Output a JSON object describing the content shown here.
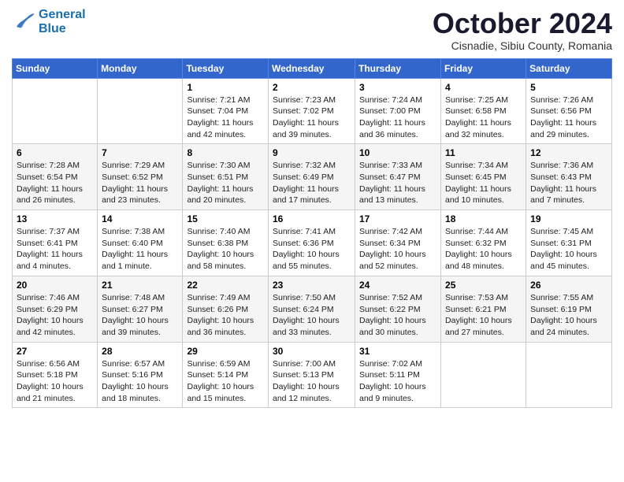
{
  "header": {
    "logo_line1": "General",
    "logo_line2": "Blue",
    "month": "October 2024",
    "location": "Cisnadie, Sibiu County, Romania"
  },
  "weekdays": [
    "Sunday",
    "Monday",
    "Tuesday",
    "Wednesday",
    "Thursday",
    "Friday",
    "Saturday"
  ],
  "weeks": [
    [
      {
        "day": "",
        "sunrise": "",
        "sunset": "",
        "daylight": ""
      },
      {
        "day": "",
        "sunrise": "",
        "sunset": "",
        "daylight": ""
      },
      {
        "day": "1",
        "sunrise": "Sunrise: 7:21 AM",
        "sunset": "Sunset: 7:04 PM",
        "daylight": "Daylight: 11 hours and 42 minutes."
      },
      {
        "day": "2",
        "sunrise": "Sunrise: 7:23 AM",
        "sunset": "Sunset: 7:02 PM",
        "daylight": "Daylight: 11 hours and 39 minutes."
      },
      {
        "day": "3",
        "sunrise": "Sunrise: 7:24 AM",
        "sunset": "Sunset: 7:00 PM",
        "daylight": "Daylight: 11 hours and 36 minutes."
      },
      {
        "day": "4",
        "sunrise": "Sunrise: 7:25 AM",
        "sunset": "Sunset: 6:58 PM",
        "daylight": "Daylight: 11 hours and 32 minutes."
      },
      {
        "day": "5",
        "sunrise": "Sunrise: 7:26 AM",
        "sunset": "Sunset: 6:56 PM",
        "daylight": "Daylight: 11 hours and 29 minutes."
      }
    ],
    [
      {
        "day": "6",
        "sunrise": "Sunrise: 7:28 AM",
        "sunset": "Sunset: 6:54 PM",
        "daylight": "Daylight: 11 hours and 26 minutes."
      },
      {
        "day": "7",
        "sunrise": "Sunrise: 7:29 AM",
        "sunset": "Sunset: 6:52 PM",
        "daylight": "Daylight: 11 hours and 23 minutes."
      },
      {
        "day": "8",
        "sunrise": "Sunrise: 7:30 AM",
        "sunset": "Sunset: 6:51 PM",
        "daylight": "Daylight: 11 hours and 20 minutes."
      },
      {
        "day": "9",
        "sunrise": "Sunrise: 7:32 AM",
        "sunset": "Sunset: 6:49 PM",
        "daylight": "Daylight: 11 hours and 17 minutes."
      },
      {
        "day": "10",
        "sunrise": "Sunrise: 7:33 AM",
        "sunset": "Sunset: 6:47 PM",
        "daylight": "Daylight: 11 hours and 13 minutes."
      },
      {
        "day": "11",
        "sunrise": "Sunrise: 7:34 AM",
        "sunset": "Sunset: 6:45 PM",
        "daylight": "Daylight: 11 hours and 10 minutes."
      },
      {
        "day": "12",
        "sunrise": "Sunrise: 7:36 AM",
        "sunset": "Sunset: 6:43 PM",
        "daylight": "Daylight: 11 hours and 7 minutes."
      }
    ],
    [
      {
        "day": "13",
        "sunrise": "Sunrise: 7:37 AM",
        "sunset": "Sunset: 6:41 PM",
        "daylight": "Daylight: 11 hours and 4 minutes."
      },
      {
        "day": "14",
        "sunrise": "Sunrise: 7:38 AM",
        "sunset": "Sunset: 6:40 PM",
        "daylight": "Daylight: 11 hours and 1 minute."
      },
      {
        "day": "15",
        "sunrise": "Sunrise: 7:40 AM",
        "sunset": "Sunset: 6:38 PM",
        "daylight": "Daylight: 10 hours and 58 minutes."
      },
      {
        "day": "16",
        "sunrise": "Sunrise: 7:41 AM",
        "sunset": "Sunset: 6:36 PM",
        "daylight": "Daylight: 10 hours and 55 minutes."
      },
      {
        "day": "17",
        "sunrise": "Sunrise: 7:42 AM",
        "sunset": "Sunset: 6:34 PM",
        "daylight": "Daylight: 10 hours and 52 minutes."
      },
      {
        "day": "18",
        "sunrise": "Sunrise: 7:44 AM",
        "sunset": "Sunset: 6:32 PM",
        "daylight": "Daylight: 10 hours and 48 minutes."
      },
      {
        "day": "19",
        "sunrise": "Sunrise: 7:45 AM",
        "sunset": "Sunset: 6:31 PM",
        "daylight": "Daylight: 10 hours and 45 minutes."
      }
    ],
    [
      {
        "day": "20",
        "sunrise": "Sunrise: 7:46 AM",
        "sunset": "Sunset: 6:29 PM",
        "daylight": "Daylight: 10 hours and 42 minutes."
      },
      {
        "day": "21",
        "sunrise": "Sunrise: 7:48 AM",
        "sunset": "Sunset: 6:27 PM",
        "daylight": "Daylight: 10 hours and 39 minutes."
      },
      {
        "day": "22",
        "sunrise": "Sunrise: 7:49 AM",
        "sunset": "Sunset: 6:26 PM",
        "daylight": "Daylight: 10 hours and 36 minutes."
      },
      {
        "day": "23",
        "sunrise": "Sunrise: 7:50 AM",
        "sunset": "Sunset: 6:24 PM",
        "daylight": "Daylight: 10 hours and 33 minutes."
      },
      {
        "day": "24",
        "sunrise": "Sunrise: 7:52 AM",
        "sunset": "Sunset: 6:22 PM",
        "daylight": "Daylight: 10 hours and 30 minutes."
      },
      {
        "day": "25",
        "sunrise": "Sunrise: 7:53 AM",
        "sunset": "Sunset: 6:21 PM",
        "daylight": "Daylight: 10 hours and 27 minutes."
      },
      {
        "day": "26",
        "sunrise": "Sunrise: 7:55 AM",
        "sunset": "Sunset: 6:19 PM",
        "daylight": "Daylight: 10 hours and 24 minutes."
      }
    ],
    [
      {
        "day": "27",
        "sunrise": "Sunrise: 6:56 AM",
        "sunset": "Sunset: 5:18 PM",
        "daylight": "Daylight: 10 hours and 21 minutes."
      },
      {
        "day": "28",
        "sunrise": "Sunrise: 6:57 AM",
        "sunset": "Sunset: 5:16 PM",
        "daylight": "Daylight: 10 hours and 18 minutes."
      },
      {
        "day": "29",
        "sunrise": "Sunrise: 6:59 AM",
        "sunset": "Sunset: 5:14 PM",
        "daylight": "Daylight: 10 hours and 15 minutes."
      },
      {
        "day": "30",
        "sunrise": "Sunrise: 7:00 AM",
        "sunset": "Sunset: 5:13 PM",
        "daylight": "Daylight: 10 hours and 12 minutes."
      },
      {
        "day": "31",
        "sunrise": "Sunrise: 7:02 AM",
        "sunset": "Sunset: 5:11 PM",
        "daylight": "Daylight: 10 hours and 9 minutes."
      },
      {
        "day": "",
        "sunrise": "",
        "sunset": "",
        "daylight": ""
      },
      {
        "day": "",
        "sunrise": "",
        "sunset": "",
        "daylight": ""
      }
    ]
  ]
}
